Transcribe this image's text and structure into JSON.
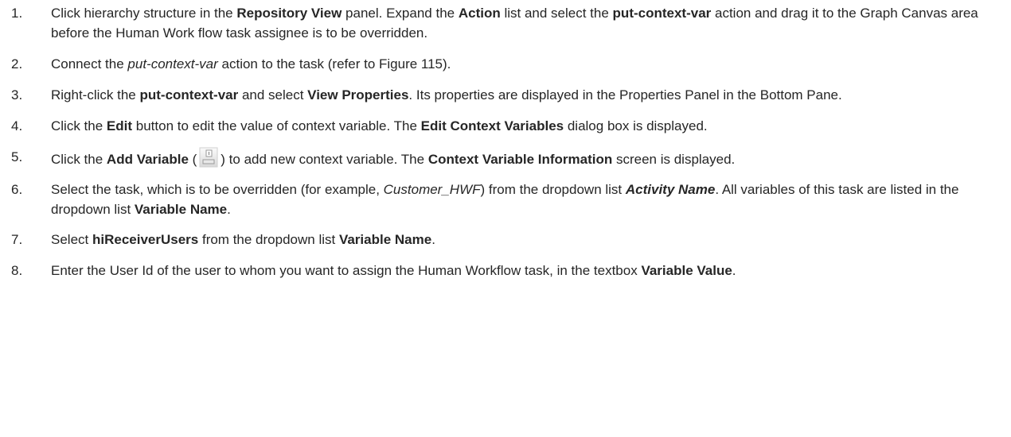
{
  "steps": [
    {
      "num": "1.",
      "parts": [
        {
          "t": "Click hierarchy structure in the "
        },
        {
          "t": "Repository View",
          "b": true
        },
        {
          "t": " panel. Expand the "
        },
        {
          "t": "Action",
          "b": true
        },
        {
          "t": " list and select the "
        },
        {
          "t": "put-context-var",
          "b": true
        },
        {
          "t": " action and drag it to the Graph Canvas area before the Human Work flow task assignee is to be overridden."
        }
      ]
    },
    {
      "num": "2.",
      "parts": [
        {
          "t": "Connect the "
        },
        {
          "t": "put-context-var",
          "i": true
        },
        {
          "t": " action to the task (refer to Figure 115)."
        }
      ]
    },
    {
      "num": "3.",
      "parts": [
        {
          "t": "Right-click the "
        },
        {
          "t": "put-context-var",
          "b": true
        },
        {
          "t": " and select "
        },
        {
          "t": "View Properties",
          "b": true
        },
        {
          "t": ". Its properties are displayed in the Properties Panel in the Bottom Pane."
        }
      ]
    },
    {
      "num": "4.",
      "parts": [
        {
          "t": "Click the "
        },
        {
          "t": "Edit",
          "b": true
        },
        {
          "t": " button to edit the value of context variable. The "
        },
        {
          "t": "Edit Context Variables",
          "b": true
        },
        {
          "t": " dialog box is displayed."
        }
      ]
    },
    {
      "num": "5.",
      "parts": [
        {
          "t": "Click the "
        },
        {
          "t": "Add Variable",
          "b": true
        },
        {
          "t": " ("
        },
        {
          "icon": "add-variable-icon"
        },
        {
          "t": ") to add new context variable. The "
        },
        {
          "t": "Context Variable Information",
          "b": true
        },
        {
          "t": " screen is displayed."
        }
      ]
    },
    {
      "num": "6.",
      "parts": [
        {
          "t": "Select the task, which is to be overridden (for example, "
        },
        {
          "t": "Customer_HWF",
          "i": true
        },
        {
          "t": ") from the dropdown list "
        },
        {
          "t": "Activity Name",
          "b": true,
          "i": true
        },
        {
          "t": ". All variables of this task are listed in the dropdown list "
        },
        {
          "t": "Variable Name",
          "b": true
        },
        {
          "t": "."
        }
      ]
    },
    {
      "num": "7.",
      "parts": [
        {
          "t": "Select "
        },
        {
          "t": "hiReceiverUsers",
          "b": true
        },
        {
          "t": " from the dropdown list "
        },
        {
          "t": "Variable Name",
          "b": true
        },
        {
          "t": "."
        }
      ]
    },
    {
      "num": "8.",
      "parts": [
        {
          "t": "Enter the User Id of the user to whom you want to assign the Human Workflow task, in the textbox "
        },
        {
          "t": "Variable Value",
          "b": true
        },
        {
          "t": "."
        }
      ]
    }
  ]
}
